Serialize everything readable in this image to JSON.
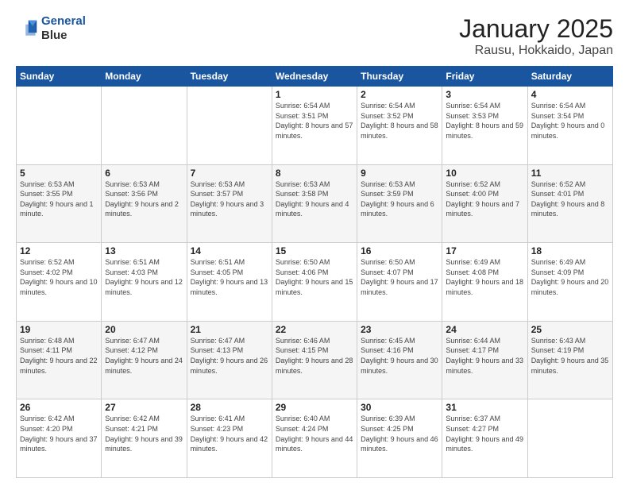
{
  "header": {
    "logo_line1": "General",
    "logo_line2": "Blue",
    "title": "January 2025",
    "subtitle": "Rausu, Hokkaido, Japan"
  },
  "days_of_week": [
    "Sunday",
    "Monday",
    "Tuesday",
    "Wednesday",
    "Thursday",
    "Friday",
    "Saturday"
  ],
  "weeks": [
    [
      {
        "num": "",
        "info": ""
      },
      {
        "num": "",
        "info": ""
      },
      {
        "num": "",
        "info": ""
      },
      {
        "num": "1",
        "info": "Sunrise: 6:54 AM\nSunset: 3:51 PM\nDaylight: 8 hours and 57 minutes."
      },
      {
        "num": "2",
        "info": "Sunrise: 6:54 AM\nSunset: 3:52 PM\nDaylight: 8 hours and 58 minutes."
      },
      {
        "num": "3",
        "info": "Sunrise: 6:54 AM\nSunset: 3:53 PM\nDaylight: 8 hours and 59 minutes."
      },
      {
        "num": "4",
        "info": "Sunrise: 6:54 AM\nSunset: 3:54 PM\nDaylight: 9 hours and 0 minutes."
      }
    ],
    [
      {
        "num": "5",
        "info": "Sunrise: 6:53 AM\nSunset: 3:55 PM\nDaylight: 9 hours and 1 minute."
      },
      {
        "num": "6",
        "info": "Sunrise: 6:53 AM\nSunset: 3:56 PM\nDaylight: 9 hours and 2 minutes."
      },
      {
        "num": "7",
        "info": "Sunrise: 6:53 AM\nSunset: 3:57 PM\nDaylight: 9 hours and 3 minutes."
      },
      {
        "num": "8",
        "info": "Sunrise: 6:53 AM\nSunset: 3:58 PM\nDaylight: 9 hours and 4 minutes."
      },
      {
        "num": "9",
        "info": "Sunrise: 6:53 AM\nSunset: 3:59 PM\nDaylight: 9 hours and 6 minutes."
      },
      {
        "num": "10",
        "info": "Sunrise: 6:52 AM\nSunset: 4:00 PM\nDaylight: 9 hours and 7 minutes."
      },
      {
        "num": "11",
        "info": "Sunrise: 6:52 AM\nSunset: 4:01 PM\nDaylight: 9 hours and 8 minutes."
      }
    ],
    [
      {
        "num": "12",
        "info": "Sunrise: 6:52 AM\nSunset: 4:02 PM\nDaylight: 9 hours and 10 minutes."
      },
      {
        "num": "13",
        "info": "Sunrise: 6:51 AM\nSunset: 4:03 PM\nDaylight: 9 hours and 12 minutes."
      },
      {
        "num": "14",
        "info": "Sunrise: 6:51 AM\nSunset: 4:05 PM\nDaylight: 9 hours and 13 minutes."
      },
      {
        "num": "15",
        "info": "Sunrise: 6:50 AM\nSunset: 4:06 PM\nDaylight: 9 hours and 15 minutes."
      },
      {
        "num": "16",
        "info": "Sunrise: 6:50 AM\nSunset: 4:07 PM\nDaylight: 9 hours and 17 minutes."
      },
      {
        "num": "17",
        "info": "Sunrise: 6:49 AM\nSunset: 4:08 PM\nDaylight: 9 hours and 18 minutes."
      },
      {
        "num": "18",
        "info": "Sunrise: 6:49 AM\nSunset: 4:09 PM\nDaylight: 9 hours and 20 minutes."
      }
    ],
    [
      {
        "num": "19",
        "info": "Sunrise: 6:48 AM\nSunset: 4:11 PM\nDaylight: 9 hours and 22 minutes."
      },
      {
        "num": "20",
        "info": "Sunrise: 6:47 AM\nSunset: 4:12 PM\nDaylight: 9 hours and 24 minutes."
      },
      {
        "num": "21",
        "info": "Sunrise: 6:47 AM\nSunset: 4:13 PM\nDaylight: 9 hours and 26 minutes."
      },
      {
        "num": "22",
        "info": "Sunrise: 6:46 AM\nSunset: 4:15 PM\nDaylight: 9 hours and 28 minutes."
      },
      {
        "num": "23",
        "info": "Sunrise: 6:45 AM\nSunset: 4:16 PM\nDaylight: 9 hours and 30 minutes."
      },
      {
        "num": "24",
        "info": "Sunrise: 6:44 AM\nSunset: 4:17 PM\nDaylight: 9 hours and 33 minutes."
      },
      {
        "num": "25",
        "info": "Sunrise: 6:43 AM\nSunset: 4:19 PM\nDaylight: 9 hours and 35 minutes."
      }
    ],
    [
      {
        "num": "26",
        "info": "Sunrise: 6:42 AM\nSunset: 4:20 PM\nDaylight: 9 hours and 37 minutes."
      },
      {
        "num": "27",
        "info": "Sunrise: 6:42 AM\nSunset: 4:21 PM\nDaylight: 9 hours and 39 minutes."
      },
      {
        "num": "28",
        "info": "Sunrise: 6:41 AM\nSunset: 4:23 PM\nDaylight: 9 hours and 42 minutes."
      },
      {
        "num": "29",
        "info": "Sunrise: 6:40 AM\nSunset: 4:24 PM\nDaylight: 9 hours and 44 minutes."
      },
      {
        "num": "30",
        "info": "Sunrise: 6:39 AM\nSunset: 4:25 PM\nDaylight: 9 hours and 46 minutes."
      },
      {
        "num": "31",
        "info": "Sunrise: 6:37 AM\nSunset: 4:27 PM\nDaylight: 9 hours and 49 minutes."
      },
      {
        "num": "",
        "info": ""
      }
    ]
  ]
}
